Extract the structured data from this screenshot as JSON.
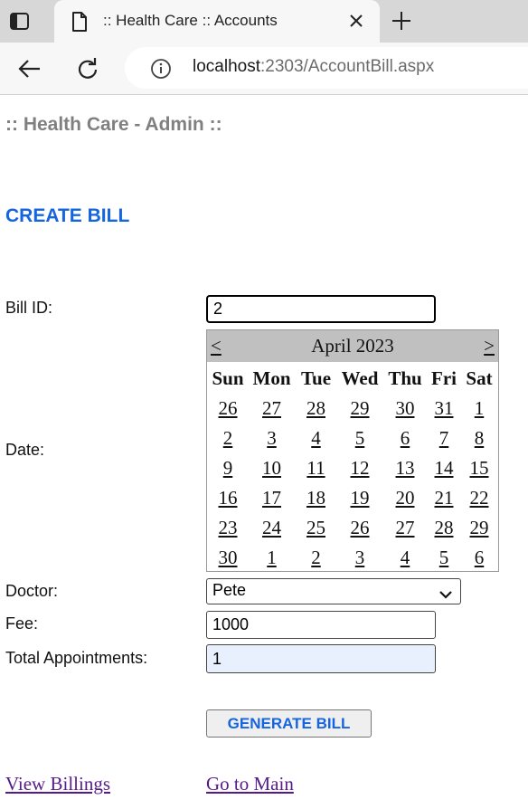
{
  "browser": {
    "tab_title": ":: Health Care :: Accounts",
    "url_host": "localhost",
    "url_rest": ":2303/AccountBill.aspx"
  },
  "page": {
    "admin_title": ":: Health Care - Admin ::",
    "section_title": "CREATE BILL"
  },
  "form": {
    "bill_id_label": "Bill ID:",
    "bill_id_value": "2",
    "date_label": "Date:",
    "doctor_label": "Doctor:",
    "doctor_value": "Pete",
    "fee_label": "Fee:",
    "fee_value": "1000",
    "total_label": "Total Appointments:",
    "total_value": "1",
    "generate_button": "GENERATE BILL"
  },
  "calendar": {
    "prev": "<",
    "next": ">",
    "month": "April 2023",
    "weekdays": [
      "Sun",
      "Mon",
      "Tue",
      "Wed",
      "Thu",
      "Fri",
      "Sat"
    ],
    "weeks": [
      [
        "26",
        "27",
        "28",
        "29",
        "30",
        "31",
        "1"
      ],
      [
        "2",
        "3",
        "4",
        "5",
        "6",
        "7",
        "8"
      ],
      [
        "9",
        "10",
        "11",
        "12",
        "13",
        "14",
        "15"
      ],
      [
        "16",
        "17",
        "18",
        "19",
        "20",
        "21",
        "22"
      ],
      [
        "23",
        "24",
        "25",
        "26",
        "27",
        "28",
        "29"
      ],
      [
        "30",
        "1",
        "2",
        "3",
        "4",
        "5",
        "6"
      ]
    ]
  },
  "links": {
    "view_billings": "View Billings",
    "go_main": "Go to Main"
  }
}
